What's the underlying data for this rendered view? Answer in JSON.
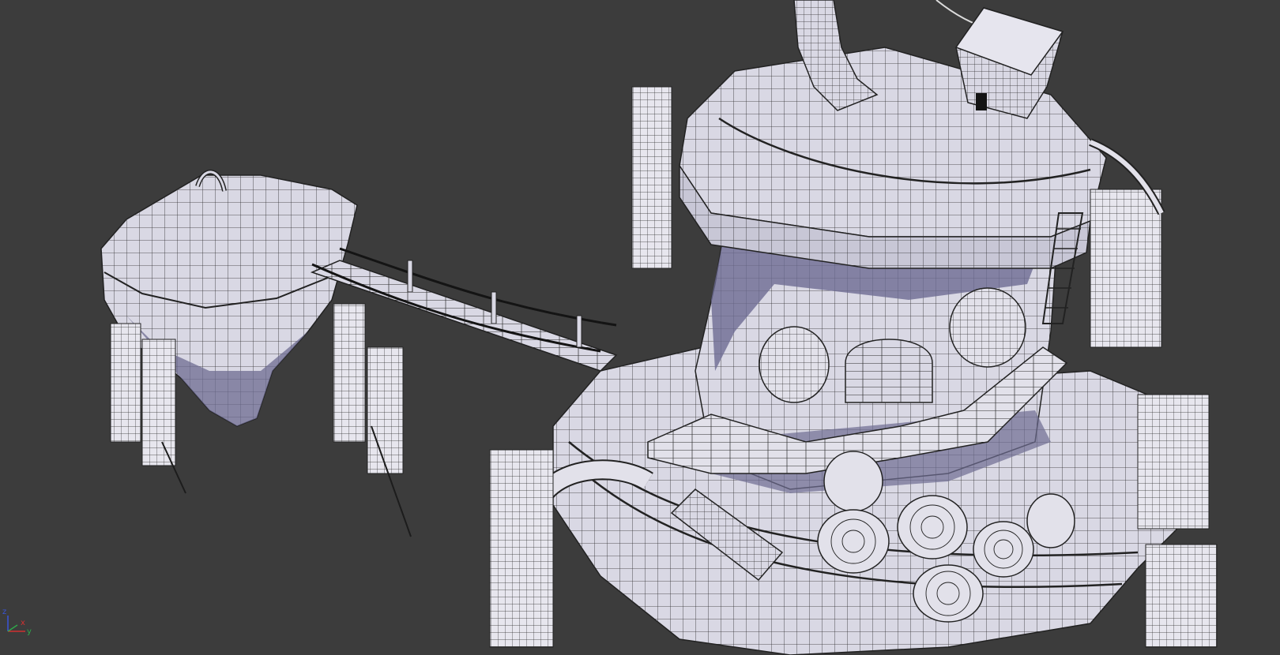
{
  "viewport": {
    "label": "",
    "background": "#3c3c3c"
  },
  "scene": {
    "mesh_fill": "#d9d8e4",
    "mesh_shadow": "#6d6c92",
    "wire_color": "#262626"
  },
  "axis_gizmo": {
    "x_label": "x",
    "y_label": "y",
    "z_label": "z",
    "colors": {
      "x": "#d03030",
      "y": "#2fa84a",
      "z": "#3a55d8"
    }
  }
}
